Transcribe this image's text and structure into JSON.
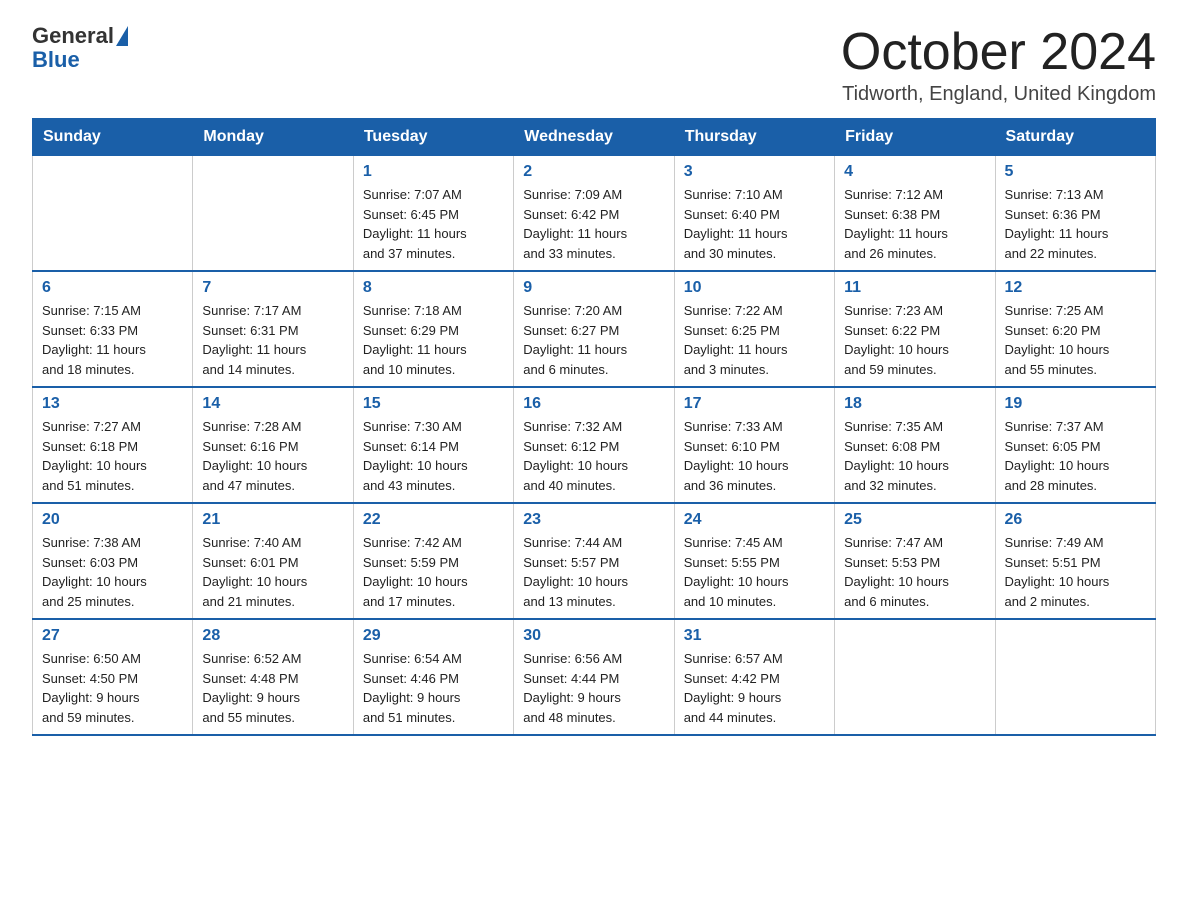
{
  "header": {
    "logo_text_general": "General",
    "logo_text_blue": "Blue",
    "month_title": "October 2024",
    "location": "Tidworth, England, United Kingdom"
  },
  "weekdays": [
    "Sunday",
    "Monday",
    "Tuesday",
    "Wednesday",
    "Thursday",
    "Friday",
    "Saturday"
  ],
  "weeks": [
    [
      {
        "day": "",
        "info": ""
      },
      {
        "day": "",
        "info": ""
      },
      {
        "day": "1",
        "info": "Sunrise: 7:07 AM\nSunset: 6:45 PM\nDaylight: 11 hours\nand 37 minutes."
      },
      {
        "day": "2",
        "info": "Sunrise: 7:09 AM\nSunset: 6:42 PM\nDaylight: 11 hours\nand 33 minutes."
      },
      {
        "day": "3",
        "info": "Sunrise: 7:10 AM\nSunset: 6:40 PM\nDaylight: 11 hours\nand 30 minutes."
      },
      {
        "day": "4",
        "info": "Sunrise: 7:12 AM\nSunset: 6:38 PM\nDaylight: 11 hours\nand 26 minutes."
      },
      {
        "day": "5",
        "info": "Sunrise: 7:13 AM\nSunset: 6:36 PM\nDaylight: 11 hours\nand 22 minutes."
      }
    ],
    [
      {
        "day": "6",
        "info": "Sunrise: 7:15 AM\nSunset: 6:33 PM\nDaylight: 11 hours\nand 18 minutes."
      },
      {
        "day": "7",
        "info": "Sunrise: 7:17 AM\nSunset: 6:31 PM\nDaylight: 11 hours\nand 14 minutes."
      },
      {
        "day": "8",
        "info": "Sunrise: 7:18 AM\nSunset: 6:29 PM\nDaylight: 11 hours\nand 10 minutes."
      },
      {
        "day": "9",
        "info": "Sunrise: 7:20 AM\nSunset: 6:27 PM\nDaylight: 11 hours\nand 6 minutes."
      },
      {
        "day": "10",
        "info": "Sunrise: 7:22 AM\nSunset: 6:25 PM\nDaylight: 11 hours\nand 3 minutes."
      },
      {
        "day": "11",
        "info": "Sunrise: 7:23 AM\nSunset: 6:22 PM\nDaylight: 10 hours\nand 59 minutes."
      },
      {
        "day": "12",
        "info": "Sunrise: 7:25 AM\nSunset: 6:20 PM\nDaylight: 10 hours\nand 55 minutes."
      }
    ],
    [
      {
        "day": "13",
        "info": "Sunrise: 7:27 AM\nSunset: 6:18 PM\nDaylight: 10 hours\nand 51 minutes."
      },
      {
        "day": "14",
        "info": "Sunrise: 7:28 AM\nSunset: 6:16 PM\nDaylight: 10 hours\nand 47 minutes."
      },
      {
        "day": "15",
        "info": "Sunrise: 7:30 AM\nSunset: 6:14 PM\nDaylight: 10 hours\nand 43 minutes."
      },
      {
        "day": "16",
        "info": "Sunrise: 7:32 AM\nSunset: 6:12 PM\nDaylight: 10 hours\nand 40 minutes."
      },
      {
        "day": "17",
        "info": "Sunrise: 7:33 AM\nSunset: 6:10 PM\nDaylight: 10 hours\nand 36 minutes."
      },
      {
        "day": "18",
        "info": "Sunrise: 7:35 AM\nSunset: 6:08 PM\nDaylight: 10 hours\nand 32 minutes."
      },
      {
        "day": "19",
        "info": "Sunrise: 7:37 AM\nSunset: 6:05 PM\nDaylight: 10 hours\nand 28 minutes."
      }
    ],
    [
      {
        "day": "20",
        "info": "Sunrise: 7:38 AM\nSunset: 6:03 PM\nDaylight: 10 hours\nand 25 minutes."
      },
      {
        "day": "21",
        "info": "Sunrise: 7:40 AM\nSunset: 6:01 PM\nDaylight: 10 hours\nand 21 minutes."
      },
      {
        "day": "22",
        "info": "Sunrise: 7:42 AM\nSunset: 5:59 PM\nDaylight: 10 hours\nand 17 minutes."
      },
      {
        "day": "23",
        "info": "Sunrise: 7:44 AM\nSunset: 5:57 PM\nDaylight: 10 hours\nand 13 minutes."
      },
      {
        "day": "24",
        "info": "Sunrise: 7:45 AM\nSunset: 5:55 PM\nDaylight: 10 hours\nand 10 minutes."
      },
      {
        "day": "25",
        "info": "Sunrise: 7:47 AM\nSunset: 5:53 PM\nDaylight: 10 hours\nand 6 minutes."
      },
      {
        "day": "26",
        "info": "Sunrise: 7:49 AM\nSunset: 5:51 PM\nDaylight: 10 hours\nand 2 minutes."
      }
    ],
    [
      {
        "day": "27",
        "info": "Sunrise: 6:50 AM\nSunset: 4:50 PM\nDaylight: 9 hours\nand 59 minutes."
      },
      {
        "day": "28",
        "info": "Sunrise: 6:52 AM\nSunset: 4:48 PM\nDaylight: 9 hours\nand 55 minutes."
      },
      {
        "day": "29",
        "info": "Sunrise: 6:54 AM\nSunset: 4:46 PM\nDaylight: 9 hours\nand 51 minutes."
      },
      {
        "day": "30",
        "info": "Sunrise: 6:56 AM\nSunset: 4:44 PM\nDaylight: 9 hours\nand 48 minutes."
      },
      {
        "day": "31",
        "info": "Sunrise: 6:57 AM\nSunset: 4:42 PM\nDaylight: 9 hours\nand 44 minutes."
      },
      {
        "day": "",
        "info": ""
      },
      {
        "day": "",
        "info": ""
      }
    ]
  ]
}
